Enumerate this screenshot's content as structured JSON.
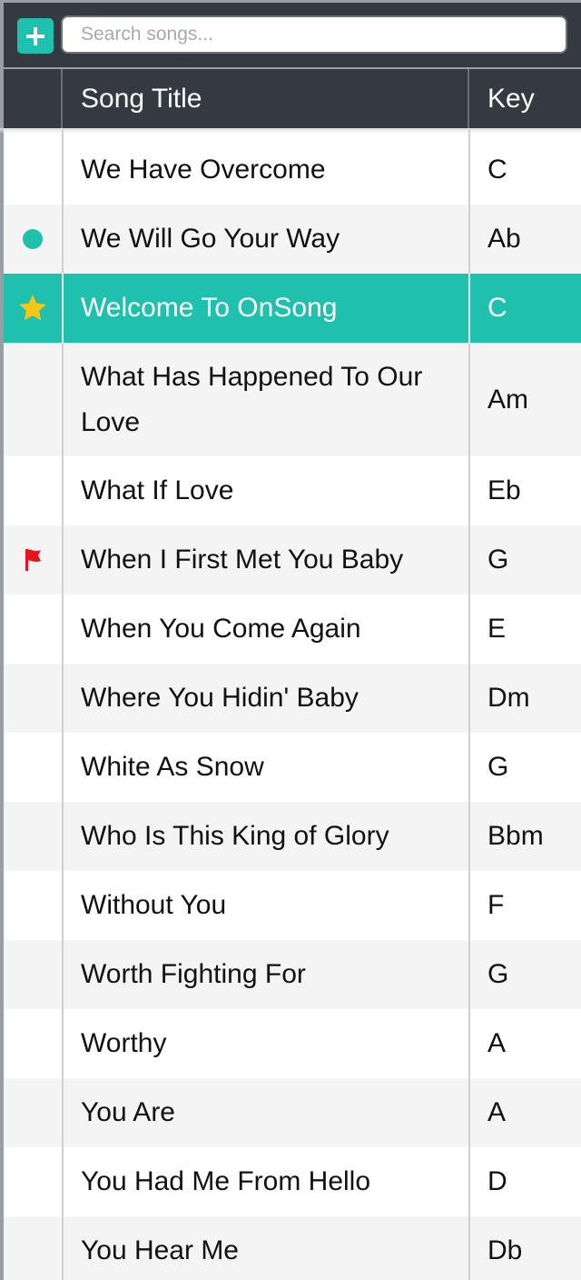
{
  "toolbar": {
    "add_label": "+",
    "search_placeholder": "Search songs...",
    "search_value": ""
  },
  "header": {
    "title": "Song Title",
    "key": "Key"
  },
  "colors": {
    "accent": "#1fc1ae",
    "header_bg": "#353a42",
    "star": "#f5c518",
    "flag": "#e8141b"
  },
  "songs": [
    {
      "title": "We Have Overcome",
      "key": "C",
      "marker": "none"
    },
    {
      "title": "We Will Go Your Way",
      "key": "Ab",
      "marker": "dot-icon"
    },
    {
      "title": "Welcome To OnSong",
      "key": "C",
      "marker": "star-icon",
      "selected": true
    },
    {
      "title": "What Has Happened To Our Love",
      "key": "Am",
      "marker": "none"
    },
    {
      "title": "What If Love",
      "key": "Eb",
      "marker": "none"
    },
    {
      "title": "When I First Met You Baby",
      "key": "G",
      "marker": "flag-icon"
    },
    {
      "title": "When You Come Again",
      "key": "E",
      "marker": "none"
    },
    {
      "title": "Where You Hidin' Baby",
      "key": "Dm",
      "marker": "none"
    },
    {
      "title": "White As Snow",
      "key": "G",
      "marker": "none"
    },
    {
      "title": "Who Is This King of Glory",
      "key": "Bbm",
      "marker": "none"
    },
    {
      "title": "Without You",
      "key": "F",
      "marker": "none"
    },
    {
      "title": "Worth Fighting For",
      "key": "G",
      "marker": "none"
    },
    {
      "title": "Worthy",
      "key": "A",
      "marker": "none"
    },
    {
      "title": "You Are",
      "key": "A",
      "marker": "none"
    },
    {
      "title": "You Had Me From Hello",
      "key": "D",
      "marker": "none"
    },
    {
      "title": "You Hear Me",
      "key": "Db",
      "marker": "none"
    }
  ]
}
